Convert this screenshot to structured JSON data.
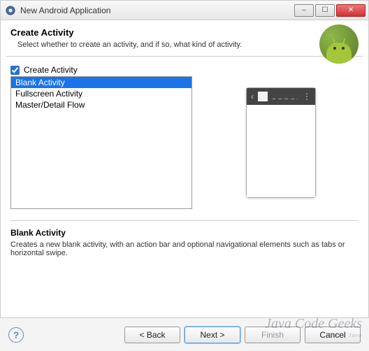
{
  "window": {
    "title": "New Android Application"
  },
  "header": {
    "title": "Create Activity",
    "subtitle": "Select whether to create an activity, and if so, what kind of activity."
  },
  "createActivity": {
    "label": "Create Activity",
    "checked": true
  },
  "activityList": {
    "items": [
      {
        "label": "Blank Activity",
        "selected": true
      },
      {
        "label": "Fullscreen Activity",
        "selected": false
      },
      {
        "label": "Master/Detail Flow",
        "selected": false
      }
    ]
  },
  "description": {
    "title": "Blank Activity",
    "text": "Creates a new blank activity, with an action bar and optional navigational elements such as tabs or horizontal swipe."
  },
  "buttons": {
    "back": "< Back",
    "next": "Next >",
    "finish": "Finish",
    "cancel": "Cancel"
  },
  "watermark": {
    "main": "Java Code Geeks",
    "sub": "Java 2 Java"
  }
}
